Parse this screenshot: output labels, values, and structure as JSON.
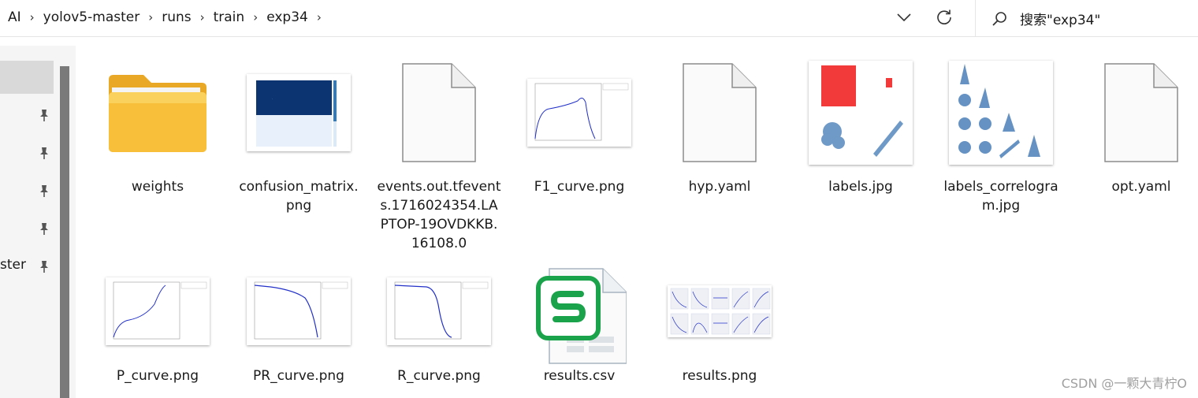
{
  "breadcrumb": [
    "AI",
    "yolov5-master",
    "runs",
    "train",
    "exp34"
  ],
  "search": {
    "placeholder": "搜索\"exp34\""
  },
  "nav": {
    "partial_label": "ster"
  },
  "files": [
    {
      "name": "weights",
      "kind": "folder-icon"
    },
    {
      "name": "confusion_matrix.png",
      "kind": "image-thumbnail"
    },
    {
      "name": "events.out.tfevents.1716024354.LAPTOP-19OVDKKB.16108.0",
      "kind": "file-icon"
    },
    {
      "name": "F1_curve.png",
      "kind": "image-thumbnail"
    },
    {
      "name": "hyp.yaml",
      "kind": "file-icon"
    },
    {
      "name": "labels.jpg",
      "kind": "image-thumbnail"
    },
    {
      "name": "labels_correlogram.jpg",
      "kind": "image-thumbnail"
    },
    {
      "name": "opt.yaml",
      "kind": "file-icon"
    },
    {
      "name": "P_curve.png",
      "kind": "image-thumbnail"
    },
    {
      "name": "PR_curve.png",
      "kind": "image-thumbnail"
    },
    {
      "name": "R_curve.png",
      "kind": "image-thumbnail"
    },
    {
      "name": "results.csv",
      "kind": "spreadsheet-icon"
    },
    {
      "name": "results.png",
      "kind": "image-thumbnail"
    }
  ],
  "watermark": "CSDN @一颗大青柠O",
  "colors": {
    "folder": "#f8c03a",
    "spreadsheet": "#1aa34a",
    "confusion": "#0b3470",
    "labels_red": "#f23a3a",
    "curve_blue": "#2230c8"
  }
}
